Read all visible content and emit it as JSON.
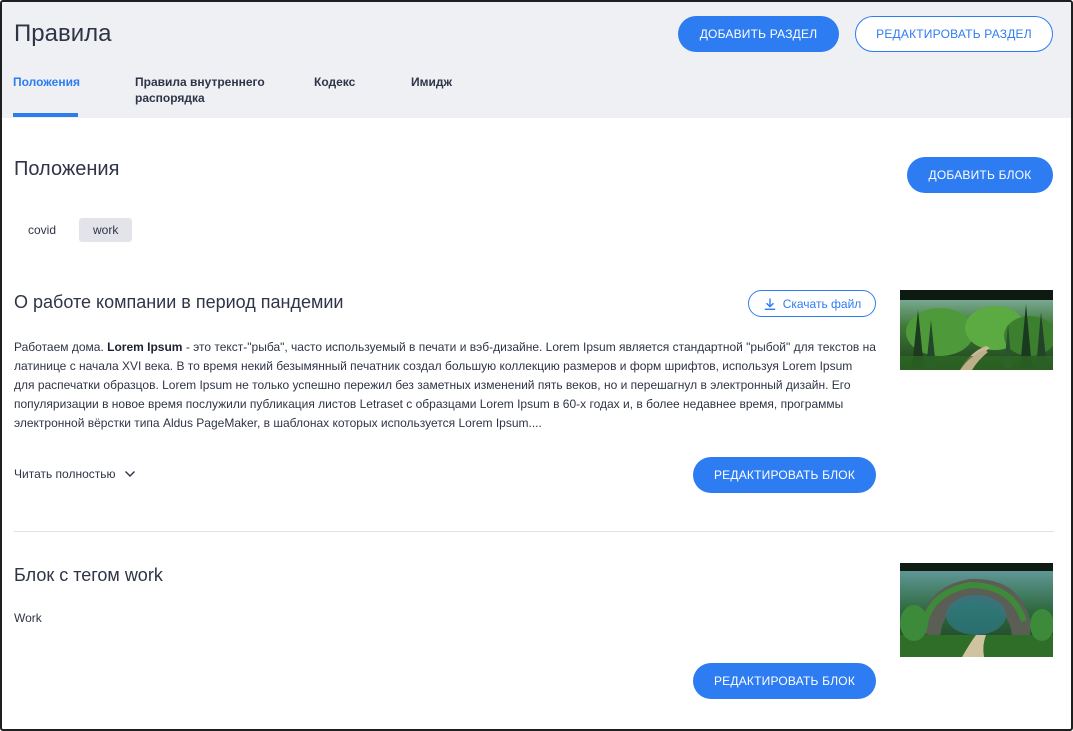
{
  "header": {
    "title": "Правила",
    "add_section_label": "ДОБАВИТЬ РАЗДЕЛ",
    "edit_section_label": "РЕДАКТИРОВАТЬ РАЗДЕЛ",
    "tabs": [
      {
        "label": "Положения",
        "active": true
      },
      {
        "label": "Правила внутреннего распорядка",
        "active": false
      },
      {
        "label": "Кодекс",
        "active": false
      },
      {
        "label": "Имидж",
        "active": false
      }
    ]
  },
  "section": {
    "title": "Положения",
    "add_block_label": "ДОБАВИТЬ БЛОК",
    "tags": [
      {
        "label": "covid",
        "selected": false
      },
      {
        "label": "work",
        "selected": true
      }
    ]
  },
  "blocks": [
    {
      "title": "О работе компании в период пандемии",
      "download_label": "Скачать файл",
      "text_intro": "Работаем дома. ",
      "text_bold": "Lorem Ipsum",
      "text_rest": " - это текст-\"рыба\", часто используемый в печати и вэб-дизайне. Lorem Ipsum является стандартной \"рыбой\" для текстов на латинице с начала XVI века. В то время некий безымянный печатник создал большую коллекцию размеров и форм шрифтов, используя Lorem Ipsum для распечатки образцов. Lorem Ipsum не только успешно пережил без заметных изменений пять веков, но и перешагнул в электронный дизайн. Его популяризации в новое время послужили публикация листов Letraset с образцами Lorem Ipsum в 60-х годах и, в более недавнее время, программы электронной вёрстки типа Aldus PageMaker, в шаблонах которых используется Lorem Ipsum....",
      "read_more_label": "Читать полностью",
      "edit_label": "РЕДАКТИРОВАТЬ БЛОК",
      "image": "forest-aquascape-image"
    },
    {
      "title": "Блок с тегом work",
      "text": "Work",
      "edit_label": "РЕДАКТИРОВАТЬ БЛОК",
      "image": "rock-cave-aquascape-image"
    }
  ],
  "colors": {
    "accent": "#2d7cf2",
    "header_bg": "#eff0f4",
    "text": "#2f3447",
    "tag_selected_bg": "#e2e4ea",
    "divider": "#e1e3e8"
  }
}
